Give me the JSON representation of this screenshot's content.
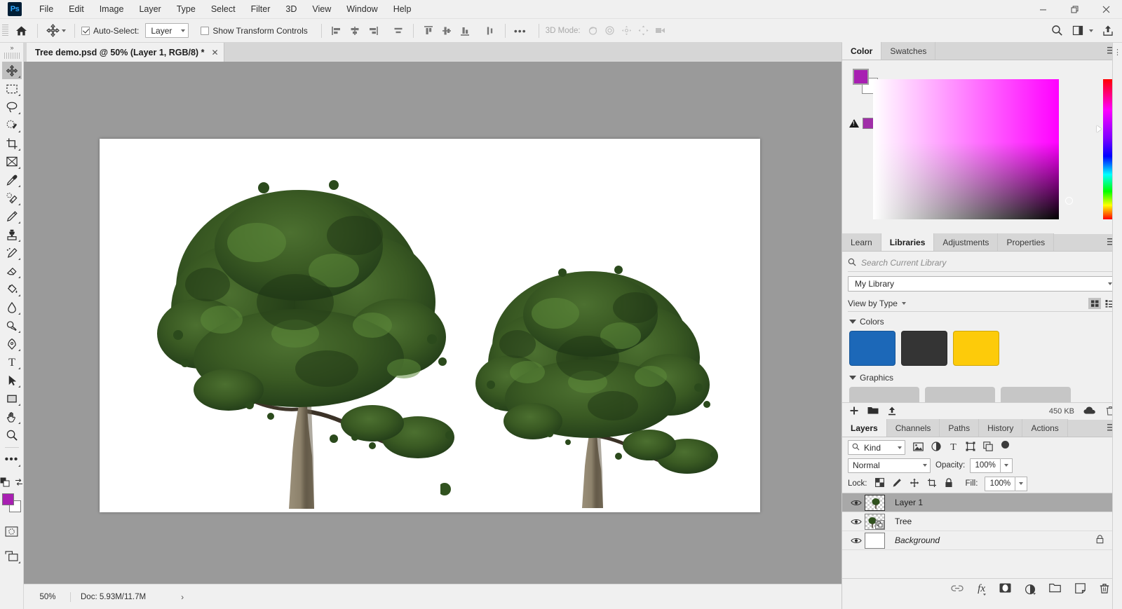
{
  "app": {
    "logo_text": "Ps",
    "menus": [
      "File",
      "Edit",
      "Image",
      "Layer",
      "Type",
      "Select",
      "Filter",
      "3D",
      "View",
      "Window",
      "Help"
    ],
    "window_controls": {
      "minimize": "minimize-icon",
      "maximize": "maximize-icon",
      "close": "close-icon"
    }
  },
  "options_bar": {
    "home_icon": "home-icon",
    "active_tool_icon": "move-tool-icon",
    "auto_select_label": "Auto-Select:",
    "auto_select_checked": true,
    "auto_select_value": "Layer",
    "show_transform_label": "Show Transform Controls",
    "show_transform_checked": false,
    "align_left_icon": "align-left-edges-icon",
    "align_hcenter_icon": "align-horizontal-centers-icon",
    "align_right_icon": "align-right-edges-icon",
    "distribute_icon": "distribute-horizontal-icon",
    "align_top_icon": "align-top-edges-icon",
    "align_vcenter_icon": "align-vertical-centers-icon",
    "align_bottom_icon": "align-bottom-edges-icon",
    "distribute_v_icon": "distribute-vertical-icon",
    "more_label": "•••",
    "mode3d_label": "3D Mode:",
    "mode3d_icons": [
      "orbit-3d-icon",
      "roll-3d-icon",
      "pan-3d-icon",
      "slide-3d-icon",
      "zoom-camera-3d-icon"
    ],
    "search_icon": "search-icon",
    "workspace_icon": "workspace-icon",
    "share_icon": "share-icon"
  },
  "document": {
    "tab_title": "Tree demo.psd @ 50% (Layer 1, RGB/8) *",
    "close_label": "✕"
  },
  "toolbar": {
    "collapse_label": "»",
    "tools": [
      {
        "name": "move-tool",
        "icon": "move-icon",
        "active": true
      },
      {
        "name": "rectangular-marquee-tool",
        "icon": "marquee-icon",
        "active": false
      },
      {
        "name": "lasso-tool",
        "icon": "lasso-icon",
        "active": false
      },
      {
        "name": "quick-selection-tool",
        "icon": "quick-select-icon",
        "active": false
      },
      {
        "name": "crop-tool",
        "icon": "crop-icon",
        "active": false
      },
      {
        "name": "frame-tool",
        "icon": "frame-icon",
        "active": false
      },
      {
        "name": "eyedropper-tool",
        "icon": "eyedropper-icon",
        "active": false
      },
      {
        "name": "spot-healing-brush-tool",
        "icon": "healing-brush-icon",
        "active": false
      },
      {
        "name": "brush-tool",
        "icon": "brush-icon",
        "active": false
      },
      {
        "name": "clone-stamp-tool",
        "icon": "clone-stamp-icon",
        "active": false
      },
      {
        "name": "history-brush-tool",
        "icon": "history-brush-icon",
        "active": false
      },
      {
        "name": "eraser-tool",
        "icon": "eraser-icon",
        "active": false
      },
      {
        "name": "gradient-tool",
        "icon": "paint-bucket-icon",
        "active": false
      },
      {
        "name": "blur-tool",
        "icon": "blur-drop-icon",
        "active": false
      },
      {
        "name": "dodge-tool",
        "icon": "dodge-icon",
        "active": false
      },
      {
        "name": "pen-tool",
        "icon": "pen-icon",
        "active": false
      },
      {
        "name": "type-tool",
        "icon": "type-icon",
        "active": false
      },
      {
        "name": "path-selection-tool",
        "icon": "path-arrow-icon",
        "active": false
      },
      {
        "name": "rectangle-tool",
        "icon": "rectangle-icon",
        "active": false
      },
      {
        "name": "hand-tool",
        "icon": "hand-icon",
        "active": false
      },
      {
        "name": "zoom-tool",
        "icon": "magnifier-icon",
        "active": false
      },
      {
        "name": "edit-toolbar",
        "icon": "ellipsis-icon",
        "active": false
      }
    ],
    "foreground_color": "#a81fb2",
    "background_color": "#ffffff",
    "swap_icon": "swap-colors-icon",
    "default_colors_icon": "default-colors-icon",
    "quickmask_icon": "quick-mask-icon",
    "screenmode_icon": "screen-mode-icon"
  },
  "canvas": {
    "background_color": "#ffffff",
    "workarea_color": "#9a9a9a",
    "trees": [
      {
        "name": "large-tree",
        "foliage_color": "#35551f",
        "trunk_color": "#8a7f6a"
      },
      {
        "name": "small-tree",
        "foliage_color": "#35551f",
        "trunk_color": "#8a7f6a"
      }
    ]
  },
  "statusbar": {
    "zoom": "50%",
    "doc_info": "Doc: 5.93M/11.7M",
    "arrow": "›"
  },
  "color_panel": {
    "tabs": [
      {
        "label": "Color",
        "active": true
      },
      {
        "label": "Swatches",
        "active": false
      }
    ],
    "menu_icon": "panel-menu-icon",
    "foreground_color": "#a81fb2",
    "background_color": "#ffffff",
    "out_of_gamut_icon": "gamut-warning-icon",
    "gamut_swatch_color": "#a02fa8",
    "spectrum_base_color": "#ff00ff"
  },
  "libraries_panel": {
    "tabs": [
      {
        "label": "Learn",
        "active": false
      },
      {
        "label": "Libraries",
        "active": true
      },
      {
        "label": "Adjustments",
        "active": false
      },
      {
        "label": "Properties",
        "active": false
      }
    ],
    "menu_icon": "panel-menu-icon",
    "search_icon": "search-icon",
    "search_placeholder": "Search Current Library",
    "library_name": "My Library",
    "view_by_label": "View by Type",
    "grid_view_icon": "grid-view-icon",
    "list_view_icon": "list-view-icon",
    "sections": [
      {
        "title": "Colors",
        "items": [
          {
            "name": "color-swatch-blue",
            "color": "#1c68b8"
          },
          {
            "name": "color-swatch-dark",
            "color": "#343434"
          },
          {
            "name": "color-swatch-yellow",
            "color": "#fdcb0a"
          }
        ]
      },
      {
        "title": "Graphics",
        "items": []
      }
    ],
    "footer": {
      "add_icon": "add-element-icon",
      "library_icon": "library-folder-icon",
      "upload_icon": "upload-icon",
      "size_label": "450 KB",
      "cloud_icon": "cloud-icon",
      "delete_icon": "trash-icon"
    }
  },
  "layers_panel": {
    "tabs": [
      {
        "label": "Layers",
        "active": true
      },
      {
        "label": "Channels",
        "active": false
      },
      {
        "label": "Paths",
        "active": false
      },
      {
        "label": "History",
        "active": false
      },
      {
        "label": "Actions",
        "active": false
      }
    ],
    "menu_icon": "panel-menu-icon",
    "filter_search_icon": "search-icon",
    "filter_kind_label": "Kind",
    "filter_icons": [
      "pixel-filter-icon",
      "adjustment-filter-icon",
      "type-filter-icon",
      "shape-filter-icon",
      "smart-object-filter-icon"
    ],
    "filter_toggle_icon": "filter-enable-toggle",
    "blend_mode": "Normal",
    "opacity_label": "Opacity:",
    "opacity_value": "100%",
    "lock_label": "Lock:",
    "lock_icons": [
      "lock-transparent-pixels-icon",
      "lock-image-pixels-icon",
      "lock-position-icon",
      "lock-artboard-nesting-icon",
      "lock-all-icon"
    ],
    "fill_label": "Fill:",
    "fill_value": "100%",
    "layers": [
      {
        "name": "Layer 1",
        "visible": true,
        "selected": true,
        "italic": false,
        "locked": false,
        "thumb": "transparent-tree-thumb"
      },
      {
        "name": "Tree",
        "visible": true,
        "selected": false,
        "italic": false,
        "locked": false,
        "thumb": "smart-object-tree-thumb"
      },
      {
        "name": "Background",
        "visible": true,
        "selected": false,
        "italic": true,
        "locked": true,
        "thumb": "white-thumb"
      }
    ],
    "footer_icons": [
      {
        "name": "link-layers-icon",
        "label": "∞"
      },
      {
        "name": "layer-style-fx-icon",
        "label": "fx"
      },
      {
        "name": "add-layer-mask-icon",
        "label": ""
      },
      {
        "name": "new-adjustment-layer-icon",
        "label": ""
      },
      {
        "name": "new-group-icon",
        "label": ""
      },
      {
        "name": "new-layer-icon",
        "label": ""
      },
      {
        "name": "delete-layer-icon",
        "label": ""
      }
    ]
  },
  "right_rail": {
    "expand_icon": "expand-panels-icon"
  }
}
